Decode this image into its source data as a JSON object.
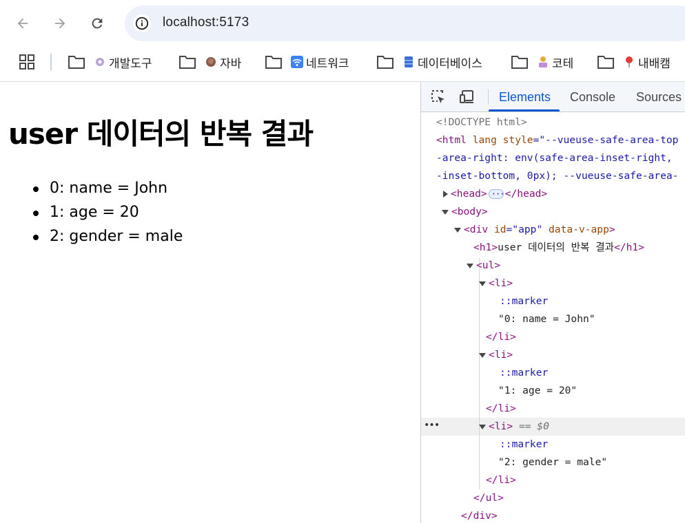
{
  "browser": {
    "url": "localhost:5173",
    "bookmarks": [
      {
        "label": "개발도구",
        "icon": "gear-icon"
      },
      {
        "label": "자바",
        "icon": "coffee-icon"
      },
      {
        "label": "네트워크",
        "icon": "wifi-icon"
      },
      {
        "label": "데이터베이스",
        "icon": "database-icon"
      },
      {
        "label": "코테",
        "icon": "person-icon"
      },
      {
        "label": "내배캠",
        "icon": "pin-icon"
      }
    ]
  },
  "page": {
    "heading": "user 데이터의 반복 결과",
    "items": [
      "0: name = John",
      "1: age = 20",
      "2: gender = male"
    ]
  },
  "devtools": {
    "tabs": [
      "Elements",
      "Console",
      "Sources"
    ],
    "active_tab": "Elements",
    "lines": {
      "doctype": "<!DOCTYPE html>",
      "html_open_tag": "<html",
      "html_attr_lang": " lang",
      "html_attr_style": " style",
      "html_style_val1": "=\"--vueuse-safe-area-top",
      "html_style_val2": "-area-right: env(safe-area-inset-right, ",
      "html_style_val3": "-inset-bottom, 0px); --vueuse-safe-area-",
      "head_open": "<head>",
      "head_close": "</head>",
      "body_open": "<body>",
      "div_open": "<div",
      "div_attr_id": " id",
      "div_val_id": "=\"app\"",
      "div_attr_data": " data-v-app",
      "div_gt": ">",
      "h1_open": "<h1>",
      "h1_text": "user 데이터의 반복 결과",
      "h1_close": "</h1>",
      "ul_open": "<ul>",
      "li_open": "<li>",
      "marker": "::marker",
      "li_text_0": "\"0: name = John\"",
      "li_text_1": "\"1: age = 20\"",
      "li_text_2": "\"2: gender = male\"",
      "li_close": "</li>",
      "selected_suffix": "== $0",
      "ul_close": "</ul>",
      "div_close": "</div>"
    }
  }
}
